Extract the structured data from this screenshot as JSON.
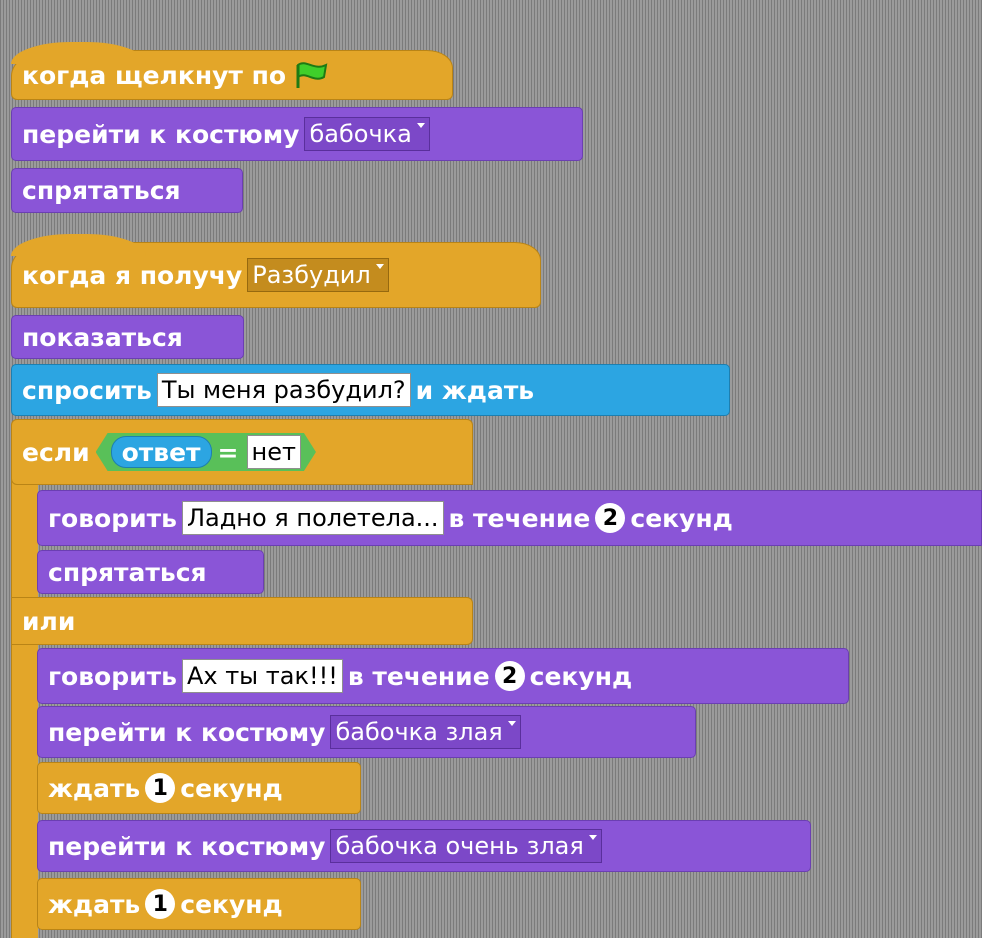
{
  "script1": {
    "hat_label": "когда щелкнут по",
    "flag_icon": "green-flag-icon",
    "costume_label": "перейти к костюму",
    "costume_value": "бабочка",
    "hide_label": "спрятаться"
  },
  "script2": {
    "hat_label": "когда я получу",
    "message_value": "Разбудил",
    "show_label": "показаться",
    "ask_label": "спросить",
    "ask_value": "Ты меня разбудил?",
    "ask_suffix": "и ждать",
    "if_label": "если",
    "answer_reporter": "ответ",
    "equals": "=",
    "compare_value": "нет",
    "say1_label": "говорить",
    "say1_value": "Ладно я полетела...",
    "say1_mid": "в течение",
    "say1_secs": "2",
    "say1_suffix": "секунд",
    "hide_label": "спрятаться",
    "else_label": "или",
    "say2_label": "говорить",
    "say2_value": "Ах ты так!!!",
    "say2_mid": "в течение",
    "say2_secs": "2",
    "say2_suffix": "секунд",
    "costume2_label": "перейти к костюму",
    "costume2_value": "бабочка злая",
    "wait1_label": "ждать",
    "wait1_value": "1",
    "wait1_suffix": "секунд",
    "costume3_label": "перейти к костюму",
    "costume3_value": "бабочка очень злая",
    "wait2_label": "ждать",
    "wait2_value": "1",
    "wait2_suffix": "секунд"
  },
  "colors": {
    "control": "#e3a629",
    "looks": "#8a55d7",
    "sensing": "#2ca5e2",
    "operators": "#59c059",
    "background": "#8a8a8a"
  }
}
